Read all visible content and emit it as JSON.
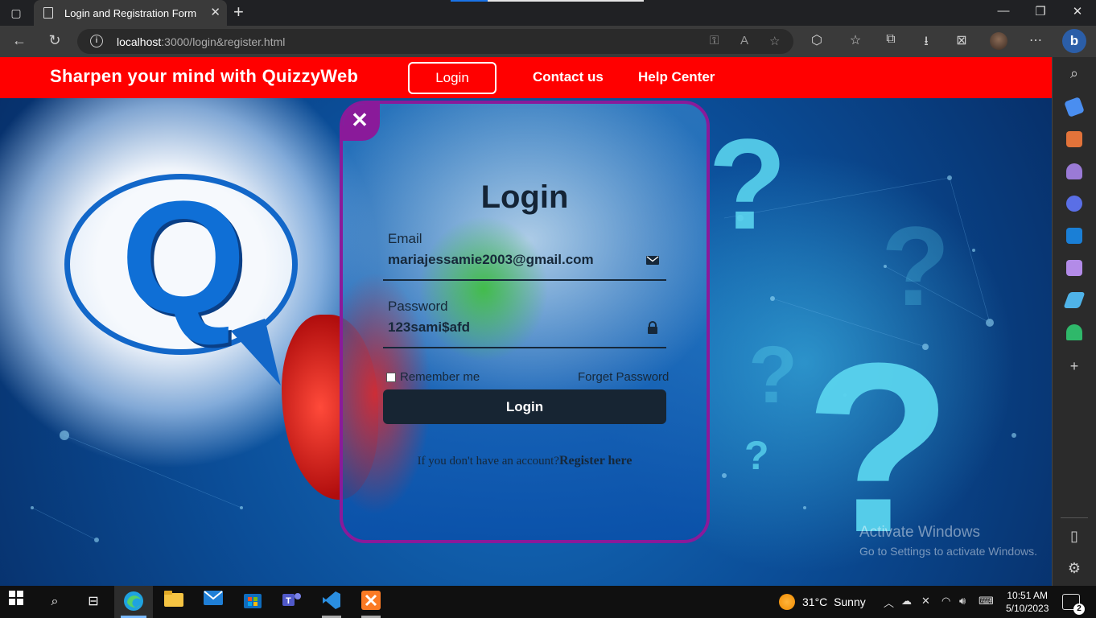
{
  "browser": {
    "tab_title": "Login and Registration Form",
    "url_host": "localhost",
    "url_path": ":3000/login&register.html"
  },
  "site": {
    "brand": "Sharpen your mind with QuizzyWeb",
    "nav": {
      "login": "Login",
      "contact": "Contact us",
      "help": "Help Center"
    }
  },
  "login_form": {
    "close_glyph": "✕",
    "title": "Login",
    "email_label": "Email",
    "email_value": "mariajessamie2003@gmail.com",
    "password_label": "Password",
    "password_value": "123sami$afd",
    "remember_label": "Remember me",
    "forget_label": "Forget Password",
    "submit_label": "Login",
    "register_prompt": "If you don't have an account?",
    "register_link": "Register here"
  },
  "background": {
    "letter": "Q",
    "qmark": "?"
  },
  "watermark": {
    "title": "Activate Windows",
    "subtitle": "Go to Settings to activate Windows."
  },
  "taskbar": {
    "temperature": "31°C",
    "condition": "Sunny",
    "time": "10:51 AM",
    "date": "5/10/2023",
    "notification_count": "2"
  },
  "colors": {
    "nav_bar": "#ff0000",
    "card_border": "#8a1a9a",
    "button_dark": "#172533"
  }
}
